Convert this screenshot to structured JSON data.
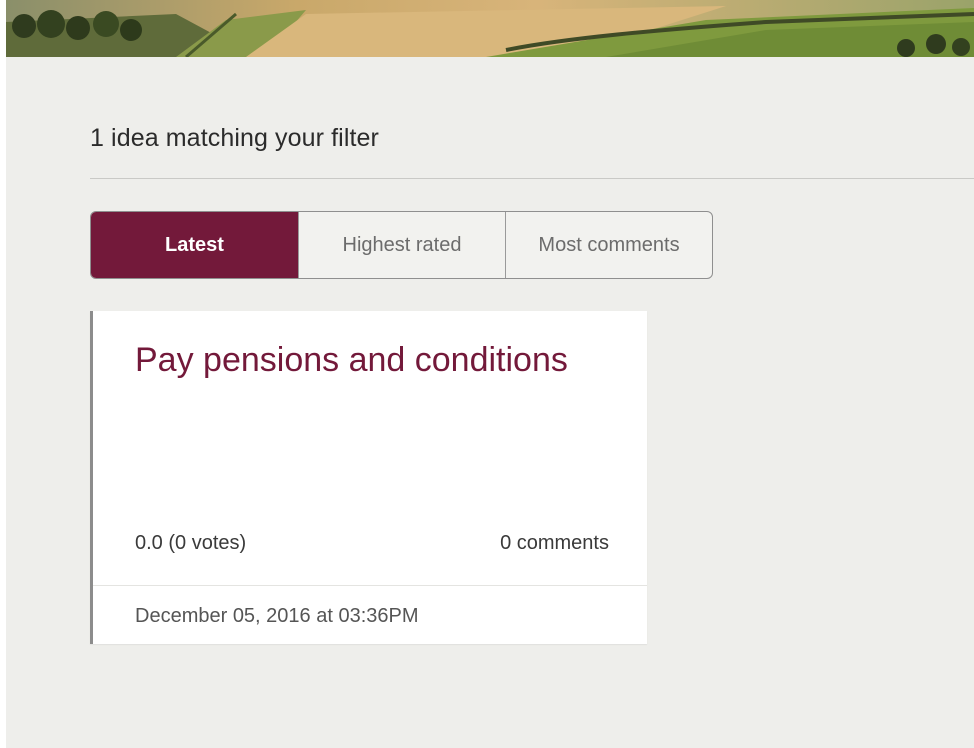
{
  "results": {
    "heading": "1 idea matching your filter"
  },
  "sort_tabs": [
    {
      "label": "Latest",
      "active": true
    },
    {
      "label": "Highest rated",
      "active": false
    },
    {
      "label": "Most comments",
      "active": false
    }
  ],
  "ideas": [
    {
      "title": "Pay pensions and conditions",
      "rating": "0.0 (0 votes)",
      "comments": "0 comments",
      "date": "December 05, 2016 at 03:36PM"
    }
  ],
  "colors": {
    "accent": "#73193a",
    "page_background": "#eeeeeb",
    "card_background": "#ffffff"
  },
  "icons": {
    "hero": "countryside-banner-image"
  }
}
